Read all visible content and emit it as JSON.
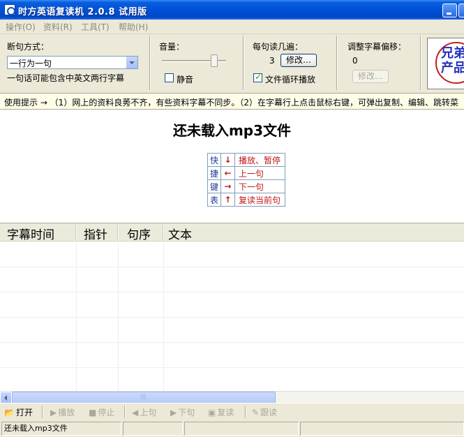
{
  "window": {
    "title": "时方英语复读机 2.0.8 试用版"
  },
  "menu": [
    {
      "label": "操作(O)"
    },
    {
      "label": "资料(R)"
    },
    {
      "label": "工具(T)"
    },
    {
      "label": "帮助(H)"
    }
  ],
  "split": {
    "label": "断句方式：",
    "selected": "一行为一句",
    "hint": "一句话可能包含中英文两行字幕"
  },
  "volume": {
    "label": "音量：",
    "level_percent": 77,
    "mute_label": "静音",
    "mute_checked": false
  },
  "repeat": {
    "label": "每句读几遍：",
    "count": "3",
    "modify_label": "修改…",
    "loop_label": "文件循环播放",
    "loop_checked": true
  },
  "offset": {
    "label": "调整字幕偏移：",
    "value": "0",
    "modify_label": "修改…"
  },
  "logo": {
    "text": "兄弟\n产品"
  },
  "tip": {
    "text": "使用提示 → （1）网上的资料良莠不齐，有些资料字幕不同步。（2）在字幕行上点击鼠标右键，可弹出复制、编辑、跳转菜"
  },
  "stage": {
    "message": "还未载入mp3文件"
  },
  "shortcuts": {
    "side_chars": [
      "快",
      "捷",
      "键",
      "表"
    ],
    "rows": [
      {
        "arrow": "↓",
        "label": "播放、暂停"
      },
      {
        "arrow": "←",
        "label": "上一句"
      },
      {
        "arrow": "→",
        "label": "下一句"
      },
      {
        "arrow": "↑",
        "label": "复读当前句"
      }
    ]
  },
  "list": {
    "columns": [
      "字幕时间",
      "指针",
      "句序",
      "文本"
    ]
  },
  "toolbar": {
    "open": "打开",
    "play": "播放",
    "stop": "停止",
    "prev": "上句",
    "next": "下句",
    "repeat": "复读",
    "follow": "跟读"
  },
  "status": {
    "text": "还未载入mp3文件"
  },
  "colors": {
    "titlebar": "#0052d8",
    "shortcut_red": "#c01818",
    "tip_bg": "#fffde8"
  }
}
